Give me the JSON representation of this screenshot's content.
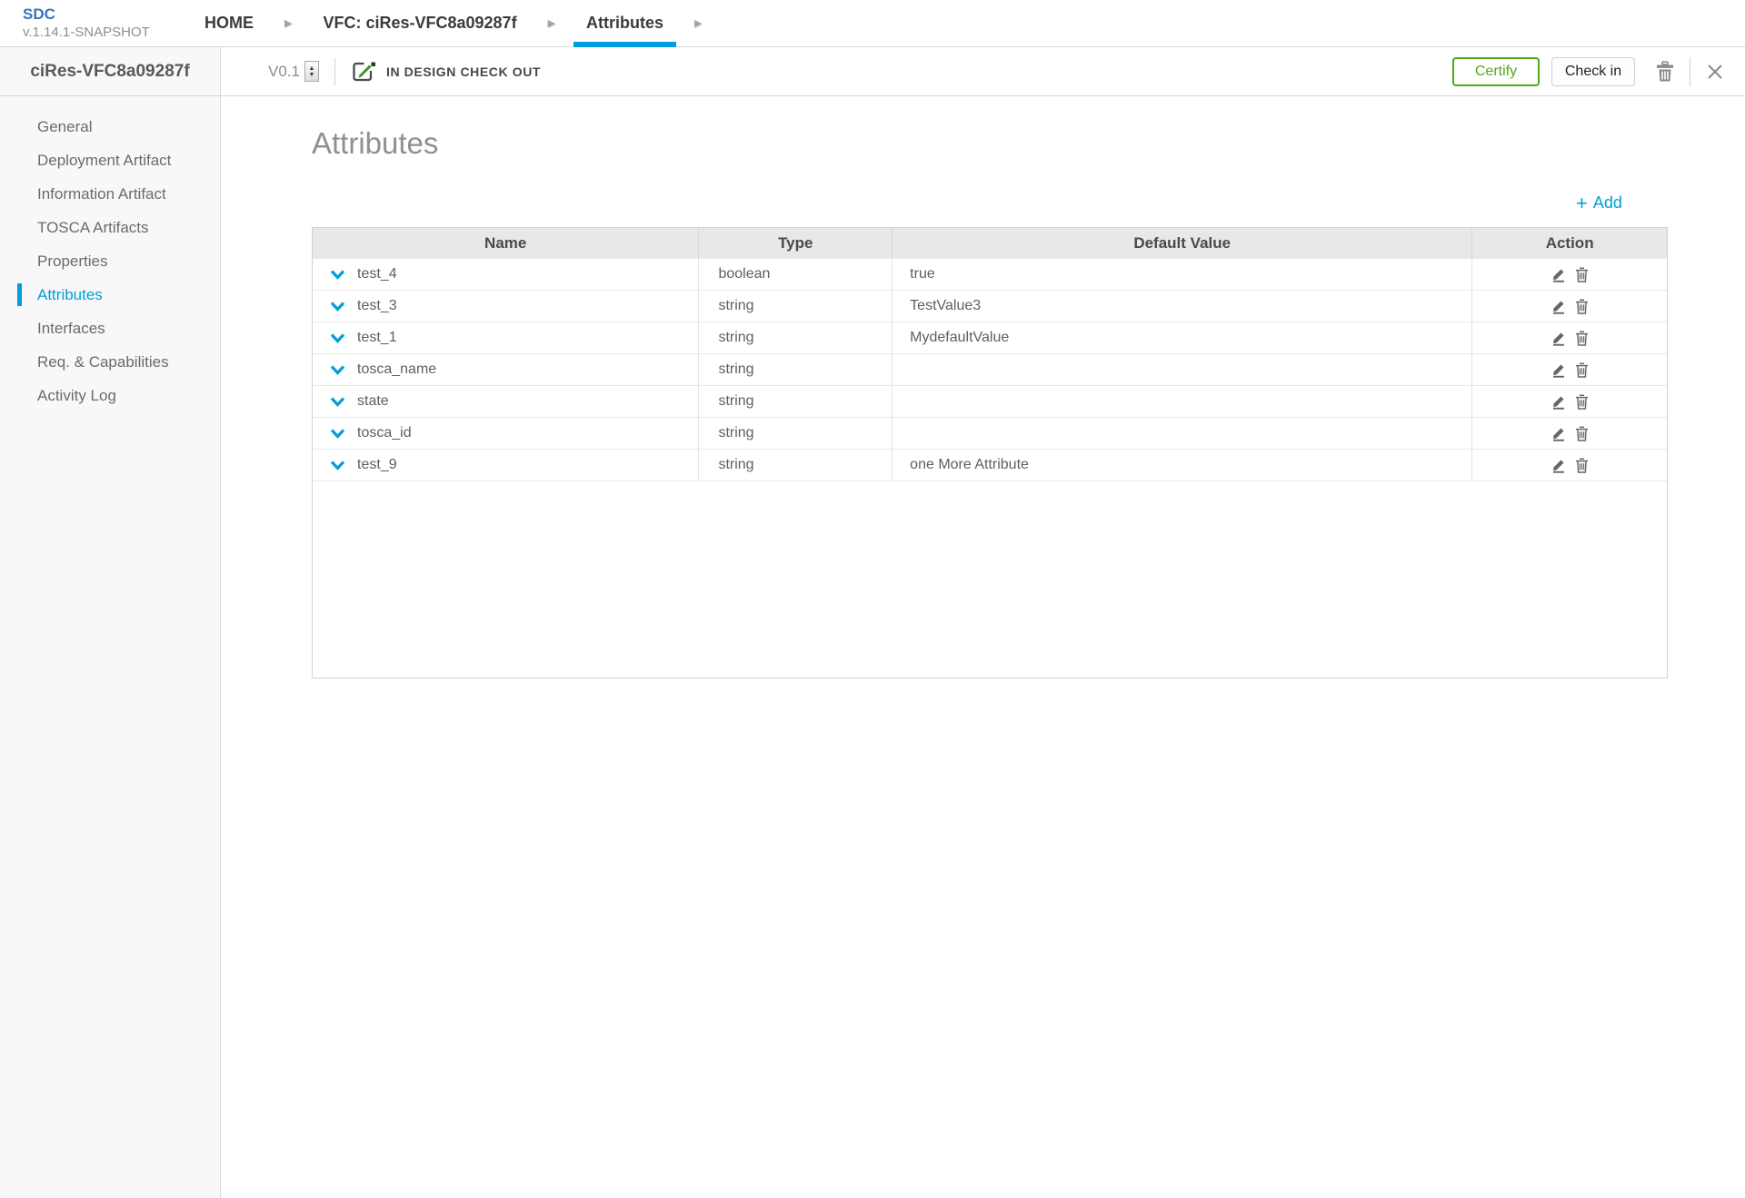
{
  "brand": {
    "name": "SDC",
    "version": "v.1.14.1-SNAPSHOT"
  },
  "nav": {
    "tabs": [
      {
        "label": "HOME",
        "active": false
      },
      {
        "label": "VFC: ciRes-VFC8a09287f",
        "active": false
      },
      {
        "label": "Attributes",
        "active": true
      }
    ]
  },
  "toolbar": {
    "version_label": "V0.1",
    "status_label": "IN DESIGN CHECK OUT",
    "certify_label": "Certify",
    "checkin_label": "Check in"
  },
  "sidebar": {
    "title": "ciRes-VFC8a09287f",
    "items": [
      {
        "label": "General",
        "active": false
      },
      {
        "label": "Deployment Artifact",
        "active": false
      },
      {
        "label": "Information Artifact",
        "active": false
      },
      {
        "label": "TOSCA Artifacts",
        "active": false
      },
      {
        "label": "Properties",
        "active": false
      },
      {
        "label": "Attributes",
        "active": true
      },
      {
        "label": "Interfaces",
        "active": false
      },
      {
        "label": "Req. & Capabilities",
        "active": false
      },
      {
        "label": "Activity Log",
        "active": false
      }
    ]
  },
  "main": {
    "heading": "Attributes",
    "add_label": "Add"
  },
  "table": {
    "columns": [
      "Name",
      "Type",
      "Default Value",
      "Action"
    ],
    "rows": [
      {
        "name": "test_4",
        "type": "boolean",
        "default": "true"
      },
      {
        "name": "test_3",
        "type": "string",
        "default": "TestValue3"
      },
      {
        "name": "test_1",
        "type": "string",
        "default": "MydefaultValue"
      },
      {
        "name": "tosca_name",
        "type": "string",
        "default": ""
      },
      {
        "name": "state",
        "type": "string",
        "default": ""
      },
      {
        "name": "tosca_id",
        "type": "string",
        "default": ""
      },
      {
        "name": "test_9",
        "type": "string",
        "default": "one More Attribute"
      }
    ]
  },
  "icons": {
    "breadcrumb_arrow": "▶",
    "add_plus": "+",
    "stepper_up": "▲",
    "stepper_down": "▼"
  },
  "colors": {
    "accent": "#009fdb",
    "green": "#54a819",
    "logo_blue": "#3577b8"
  }
}
